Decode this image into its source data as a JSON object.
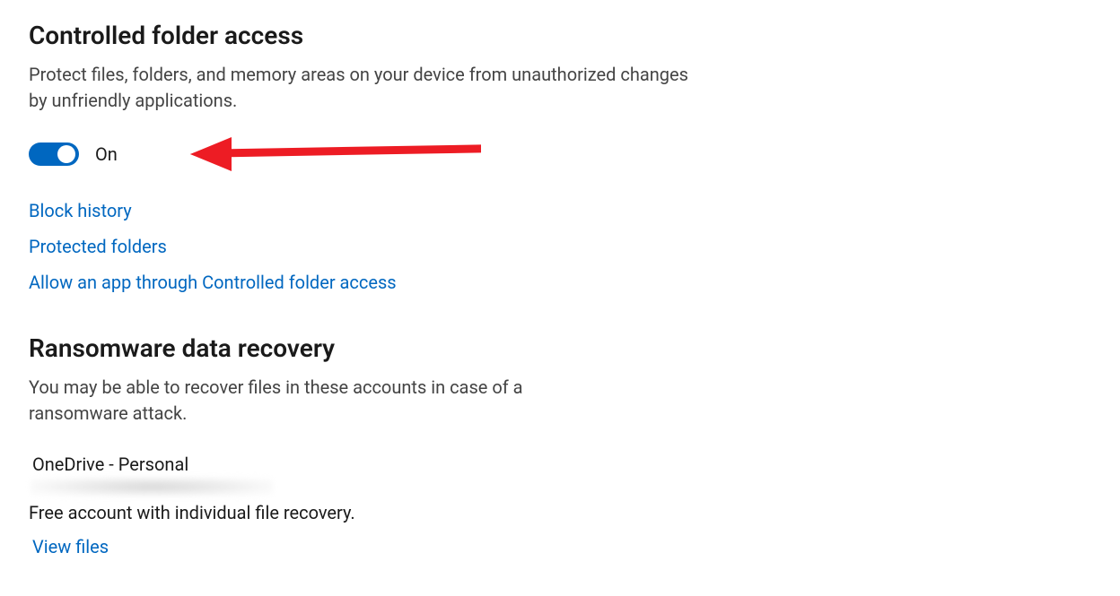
{
  "controlled_folder_access": {
    "heading": "Controlled folder access",
    "description": "Protect files, folders, and memory areas on your device from unauthorized changes by unfriendly applications.",
    "toggle": {
      "state": "on",
      "label": "On"
    },
    "links": {
      "block_history": "Block history",
      "protected_folders": "Protected folders",
      "allow_app": "Allow an app through Controlled folder access"
    }
  },
  "ransomware_recovery": {
    "heading": "Ransomware data recovery",
    "description": "You may be able to recover files in these accounts in case of a ransomware attack.",
    "account": {
      "name": "OneDrive - Personal",
      "note": "Free account with individual file recovery.",
      "view_files": "View files"
    }
  },
  "colors": {
    "link": "#0067c0",
    "toggle_on": "#0067c0",
    "arrow": "#ed1c24"
  }
}
